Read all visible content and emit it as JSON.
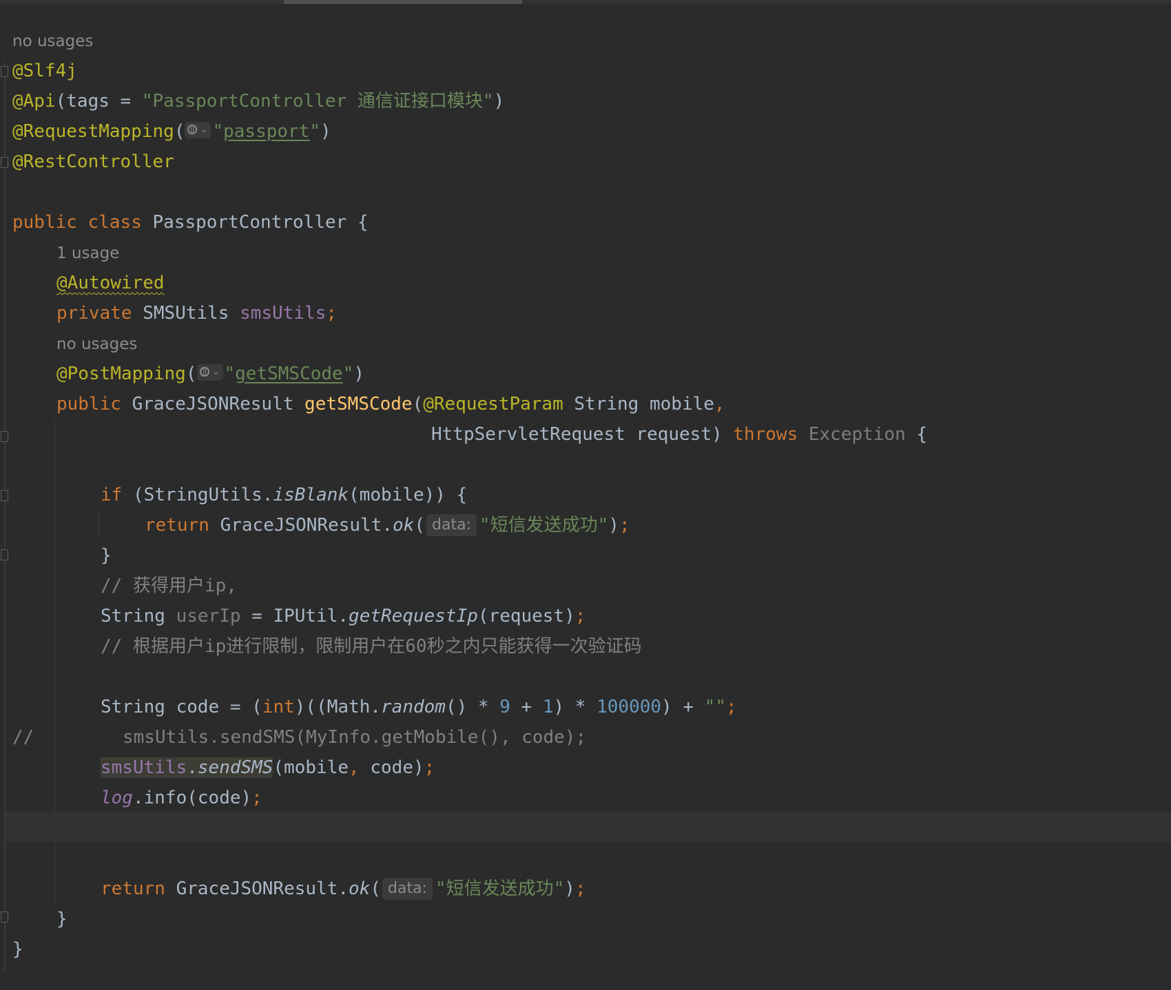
{
  "editor": {
    "language": "java",
    "hints": {
      "no_usages": "no usages",
      "one_usage": "1 usage",
      "data_param": "data:"
    },
    "code": {
      "a_slf4j": "@Slf4j",
      "a_api": "@Api",
      "api_open": "(tags = ",
      "api_tags": "\"PassportController 通信证接口模块\"",
      "api_close": ")",
      "a_request_mapping": "@RequestMapping",
      "rm_open": "(",
      "q": "\"",
      "rm_path": "passport",
      "rm_close": ")",
      "a_rest_controller": "@RestController",
      "kw_public": "public",
      "kw_class": "class",
      "class_name": "PassportController",
      "brace_open": "{",
      "brace_close": "}",
      "a_autowired": "@Autowired",
      "kw_private": "private",
      "type_smsutils": "SMSUtils",
      "field_smsutils": "smsUtils",
      "semicolon": ";",
      "a_post_mapping": "@PostMapping",
      "pm_path": "getSMSCode",
      "type_result": "GraceJSONResult",
      "method_name": "getSMSCode",
      "paren_open": "(",
      "a_request_param": "@RequestParam",
      "param1": "String mobile",
      "comma": ",",
      "param2": "HttpServletRequest request)",
      "kw_throws": "throws",
      "exception": "Exception",
      "kw_if": "if",
      "if_cond_a": "(StringUtils.",
      "is_blank": "isBlank",
      "if_cond_b": "(mobile)) {",
      "kw_return": "return",
      "result_class": "GraceJSONResult.",
      "ok": "ok",
      "sms_ok_msg": "\"短信发送成功\"",
      "close_stmt": ")",
      "comment1": "// 获得用户ip,",
      "type_string": "String",
      "var_user_ip": "userIp",
      "eq": " = ",
      "iputil": "IPUtil.",
      "get_request_ip": "getRequestIp",
      "arg_request": "(request)",
      "comment2": "// 根据用户ip进行限制，限制用户在60秒之内只能获得一次验证码",
      "code_decl": "String code = (",
      "kw_int": "int",
      "math_open": ")((Math.",
      "random": "random",
      "mul_a": "() * ",
      "n9": "9",
      "plus": " + ",
      "n1": "1",
      "mul_b": ") * ",
      "n100000": "100000",
      "plus_empty": ") + ",
      "empty_str": "\"\"",
      "commented_marker": "//",
      "commented_code": "smsUtils.sendSMS(MyInfo.getMobile(), code);",
      "sms_field": "smsUtils",
      "dot": ".",
      "send_sms": "sendSMS",
      "send_args_a": "(mobile",
      "send_args_b": " code)",
      "log": "log",
      "log_info": ".info(code)"
    }
  }
}
